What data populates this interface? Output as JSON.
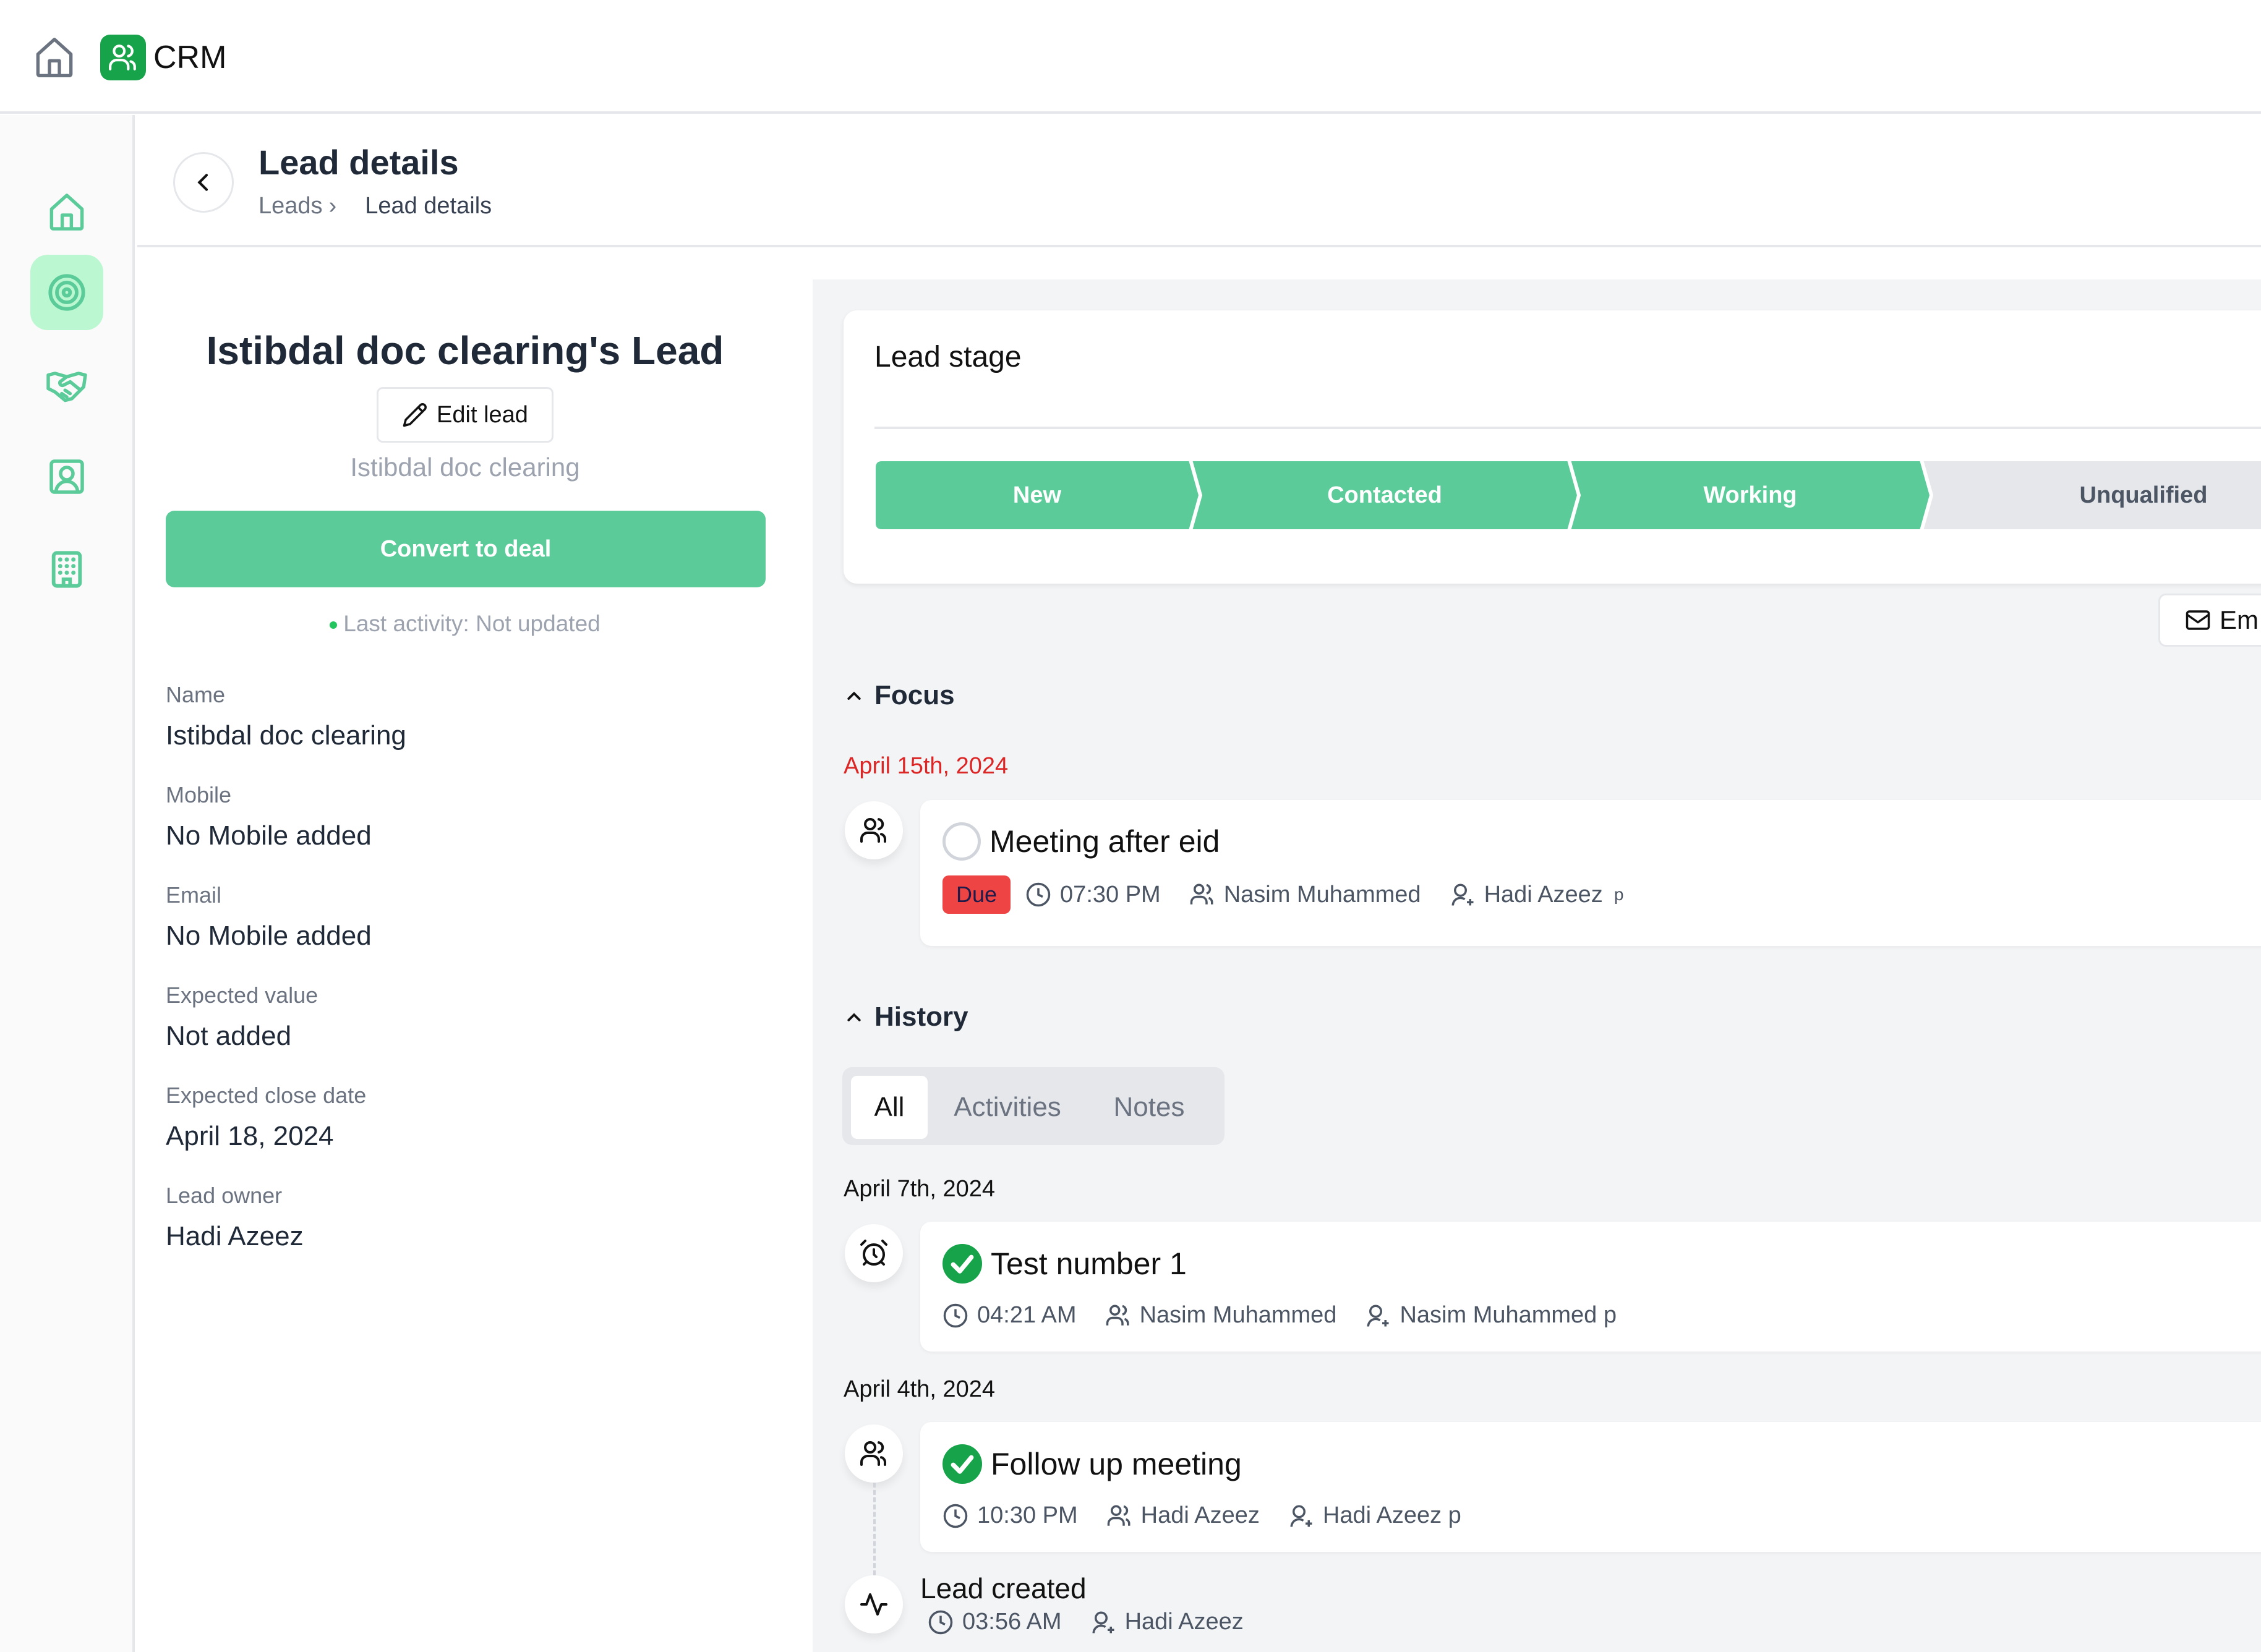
{
  "app": {
    "name": "CRM"
  },
  "sidebar": {
    "items": [
      {
        "name": "home",
        "icon": "home-icon",
        "active": false
      },
      {
        "name": "leads",
        "icon": "target-icon",
        "active": true
      },
      {
        "name": "deals",
        "icon": "handshake-icon",
        "active": false
      },
      {
        "name": "contacts",
        "icon": "contact-card-icon",
        "active": false
      },
      {
        "name": "companies",
        "icon": "building-icon",
        "active": false
      }
    ]
  },
  "header": {
    "title": "Lead details",
    "breadcrumb": [
      "Leads",
      "Lead details"
    ],
    "breadcrumb_separator": "›"
  },
  "lead": {
    "title": "Istibdal doc clearing's Lead",
    "edit_label": "Edit lead",
    "subtitle": "Istibdal doc clearing",
    "convert_label": "Convert to deal",
    "last_activity": "Last activity: Not updated",
    "fields": [
      {
        "label": "Name",
        "value": "Istibdal doc clearing"
      },
      {
        "label": "Mobile",
        "value": "No Mobile added"
      },
      {
        "label": "Email",
        "value": "No Mobile added"
      },
      {
        "label": "Expected value",
        "value": "Not added"
      },
      {
        "label": "Expected close date",
        "value": "April 18, 2024"
      },
      {
        "label": "Lead owner",
        "value": "Hadi Azeez"
      }
    ]
  },
  "stage": {
    "title": "Lead stage",
    "steps": [
      {
        "label": "New",
        "completed": true
      },
      {
        "label": "Contacted",
        "completed": true
      },
      {
        "label": "Working",
        "completed": true
      },
      {
        "label": "Unqualified",
        "completed": false
      }
    ],
    "colors": {
      "completed": "#5acb99",
      "pending": "#e5e7eb"
    }
  },
  "email_button": {
    "label": "Em"
  },
  "focus": {
    "heading": "Focus",
    "date": "April 15th, 2024",
    "items": [
      {
        "title": "Meeting after eid",
        "status": "Due",
        "time": "07:30 PM",
        "participants": "Nasim Muhammed",
        "assignee": "Hadi Azeez",
        "assignee_suffix": "p",
        "type_icon": "users-icon",
        "done": false
      }
    ]
  },
  "history": {
    "heading": "History",
    "tabs": [
      {
        "label": "All",
        "active": true
      },
      {
        "label": "Activities",
        "active": false
      },
      {
        "label": "Notes",
        "active": false
      }
    ],
    "groups": [
      {
        "date": "April 7th, 2024",
        "items": [
          {
            "title": "Test number 1",
            "time": "04:21 AM",
            "participants": "Nasim Muhammed",
            "assignee": "Nasim Muhammed p",
            "type_icon": "alarm-clock-icon",
            "done": true
          }
        ]
      },
      {
        "date": "April 4th, 2024",
        "items": [
          {
            "title": "Follow up meeting",
            "time": "10:30 PM",
            "participants": "Hadi Azeez",
            "assignee": "Hadi Azeez p",
            "type_icon": "users-icon",
            "done": true
          }
        ]
      }
    ],
    "created": {
      "title": "Lead created",
      "time": "03:56 AM",
      "by": "Hadi Azeez",
      "icon": "activity-icon"
    }
  }
}
